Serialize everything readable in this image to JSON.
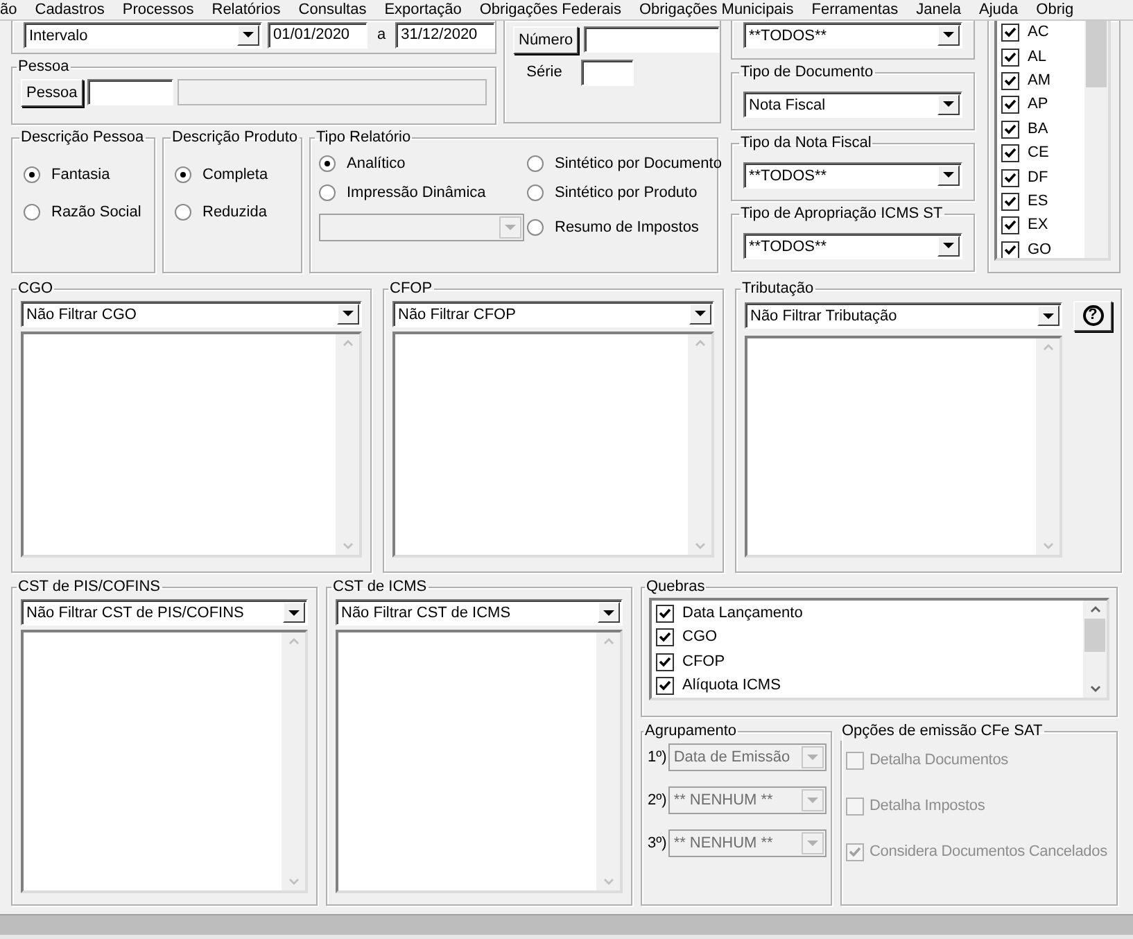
{
  "menu": [
    "ão",
    "Cadastros",
    "Processos",
    "Relatórios",
    "Consultas",
    "Exportação",
    "Obrigações Federais",
    "Obrigações Municipais",
    "Ferramentas",
    "Janela",
    "Ajuda",
    "Obrig"
  ],
  "period": {
    "mode": "Intervalo",
    "start": "01/01/2020",
    "separator": "a",
    "end": "31/12/2020"
  },
  "pessoa": {
    "title": "Pessoa",
    "button": "Pessoa"
  },
  "documento": {
    "numero_button": "Número",
    "serie_label": "Série"
  },
  "top_filter": {
    "value": "**TODOS**"
  },
  "descricao_pessoa": {
    "title": "Descrição Pessoa",
    "options": [
      {
        "label": "Fantasia",
        "selected": true
      },
      {
        "label": "Razão Social",
        "selected": false
      }
    ]
  },
  "descricao_produto": {
    "title": "Descrição Produto",
    "options": [
      {
        "label": "Completa",
        "selected": true
      },
      {
        "label": "Reduzida",
        "selected": false
      }
    ]
  },
  "tipo_relatorio": {
    "title": "Tipo Relatório",
    "view_combo_disabled": true,
    "options": [
      {
        "label": "Analítico",
        "selected": true
      },
      {
        "label": "Sintético por Documento",
        "selected": false
      },
      {
        "label": "Impressão Dinâmica",
        "selected": false
      },
      {
        "label": "Sintético por Produto",
        "selected": false
      },
      {
        "label": "Resumo de Impostos",
        "selected": false
      }
    ]
  },
  "filters_right": [
    {
      "title": "Tipo de Documento",
      "value": "Nota Fiscal"
    },
    {
      "title": "Tipo da Nota Fiscal",
      "value": "**TODOS**"
    },
    {
      "title": "Tipo de Apropriação ICMS ST",
      "value": "**TODOS**"
    }
  ],
  "uf_list": [
    {
      "label": "AC",
      "checked": true
    },
    {
      "label": "AL",
      "checked": true
    },
    {
      "label": "AM",
      "checked": true
    },
    {
      "label": "AP",
      "checked": true
    },
    {
      "label": "BA",
      "checked": true
    },
    {
      "label": "CE",
      "checked": true
    },
    {
      "label": "DF",
      "checked": true
    },
    {
      "label": "ES",
      "checked": true
    },
    {
      "label": "EX",
      "checked": true
    },
    {
      "label": "GO",
      "checked": true
    }
  ],
  "filter_panels": [
    {
      "title": "CGO",
      "value": "Não Filtrar CGO"
    },
    {
      "title": "CFOP",
      "value": "Não Filtrar CFOP"
    },
    {
      "title": "Tributação",
      "value": "Não Filtrar Tributação"
    }
  ],
  "help_button": "?",
  "cst_panels": [
    {
      "title": "CST de PIS/COFINS",
      "value": "Não Filtrar CST de PIS/COFINS"
    },
    {
      "title": "CST de ICMS",
      "value": "Não Filtrar CST de ICMS"
    }
  ],
  "quebras": {
    "title": "Quebras",
    "items": [
      {
        "label": "Data Lançamento",
        "checked": true
      },
      {
        "label": "CGO",
        "checked": true
      },
      {
        "label": "CFOP",
        "checked": true
      },
      {
        "label": "Alíquota ICMS",
        "checked": true
      }
    ]
  },
  "agrupamento": {
    "title": "Agrupamento",
    "disabled": true,
    "rows": [
      {
        "label": "1º)",
        "value": "Data de Emissão"
      },
      {
        "label": "2º)",
        "value": "** NENHUM **"
      },
      {
        "label": "3º)",
        "value": "** NENHUM **"
      }
    ]
  },
  "opcoes_cfe": {
    "title": "Opções de emissão CFe SAT",
    "disabled": true,
    "items": [
      {
        "label": "Detalha Documentos",
        "checked": false
      },
      {
        "label": "Detalha Impostos",
        "checked": false
      },
      {
        "label": "Considera Documentos Cancelados",
        "checked": true
      }
    ]
  }
}
